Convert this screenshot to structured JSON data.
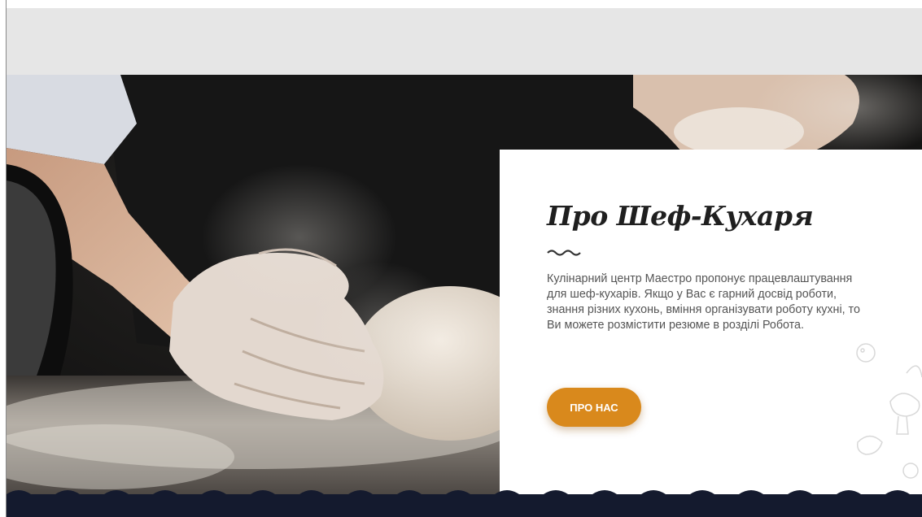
{
  "about": {
    "title": "Про Шеф-Кухаря",
    "text": "Кулінарний центр Маестро пропонує працевлаштування для шеф-кухарів. Якщо у Вас є гарний досвід роботи, знання різних кухонь, вміння організувати роботу кухні, то Ви можете розмістити резюме в розділі Робота.",
    "button_label": "ПРО НАС"
  },
  "hero_image": {
    "alt": "hands kneading dough with flour"
  },
  "colors": {
    "accent": "#d9891c",
    "footer": "#141a2e",
    "top_band": "#e6e6e6",
    "title": "#1f1f1f",
    "text": "#555555"
  }
}
